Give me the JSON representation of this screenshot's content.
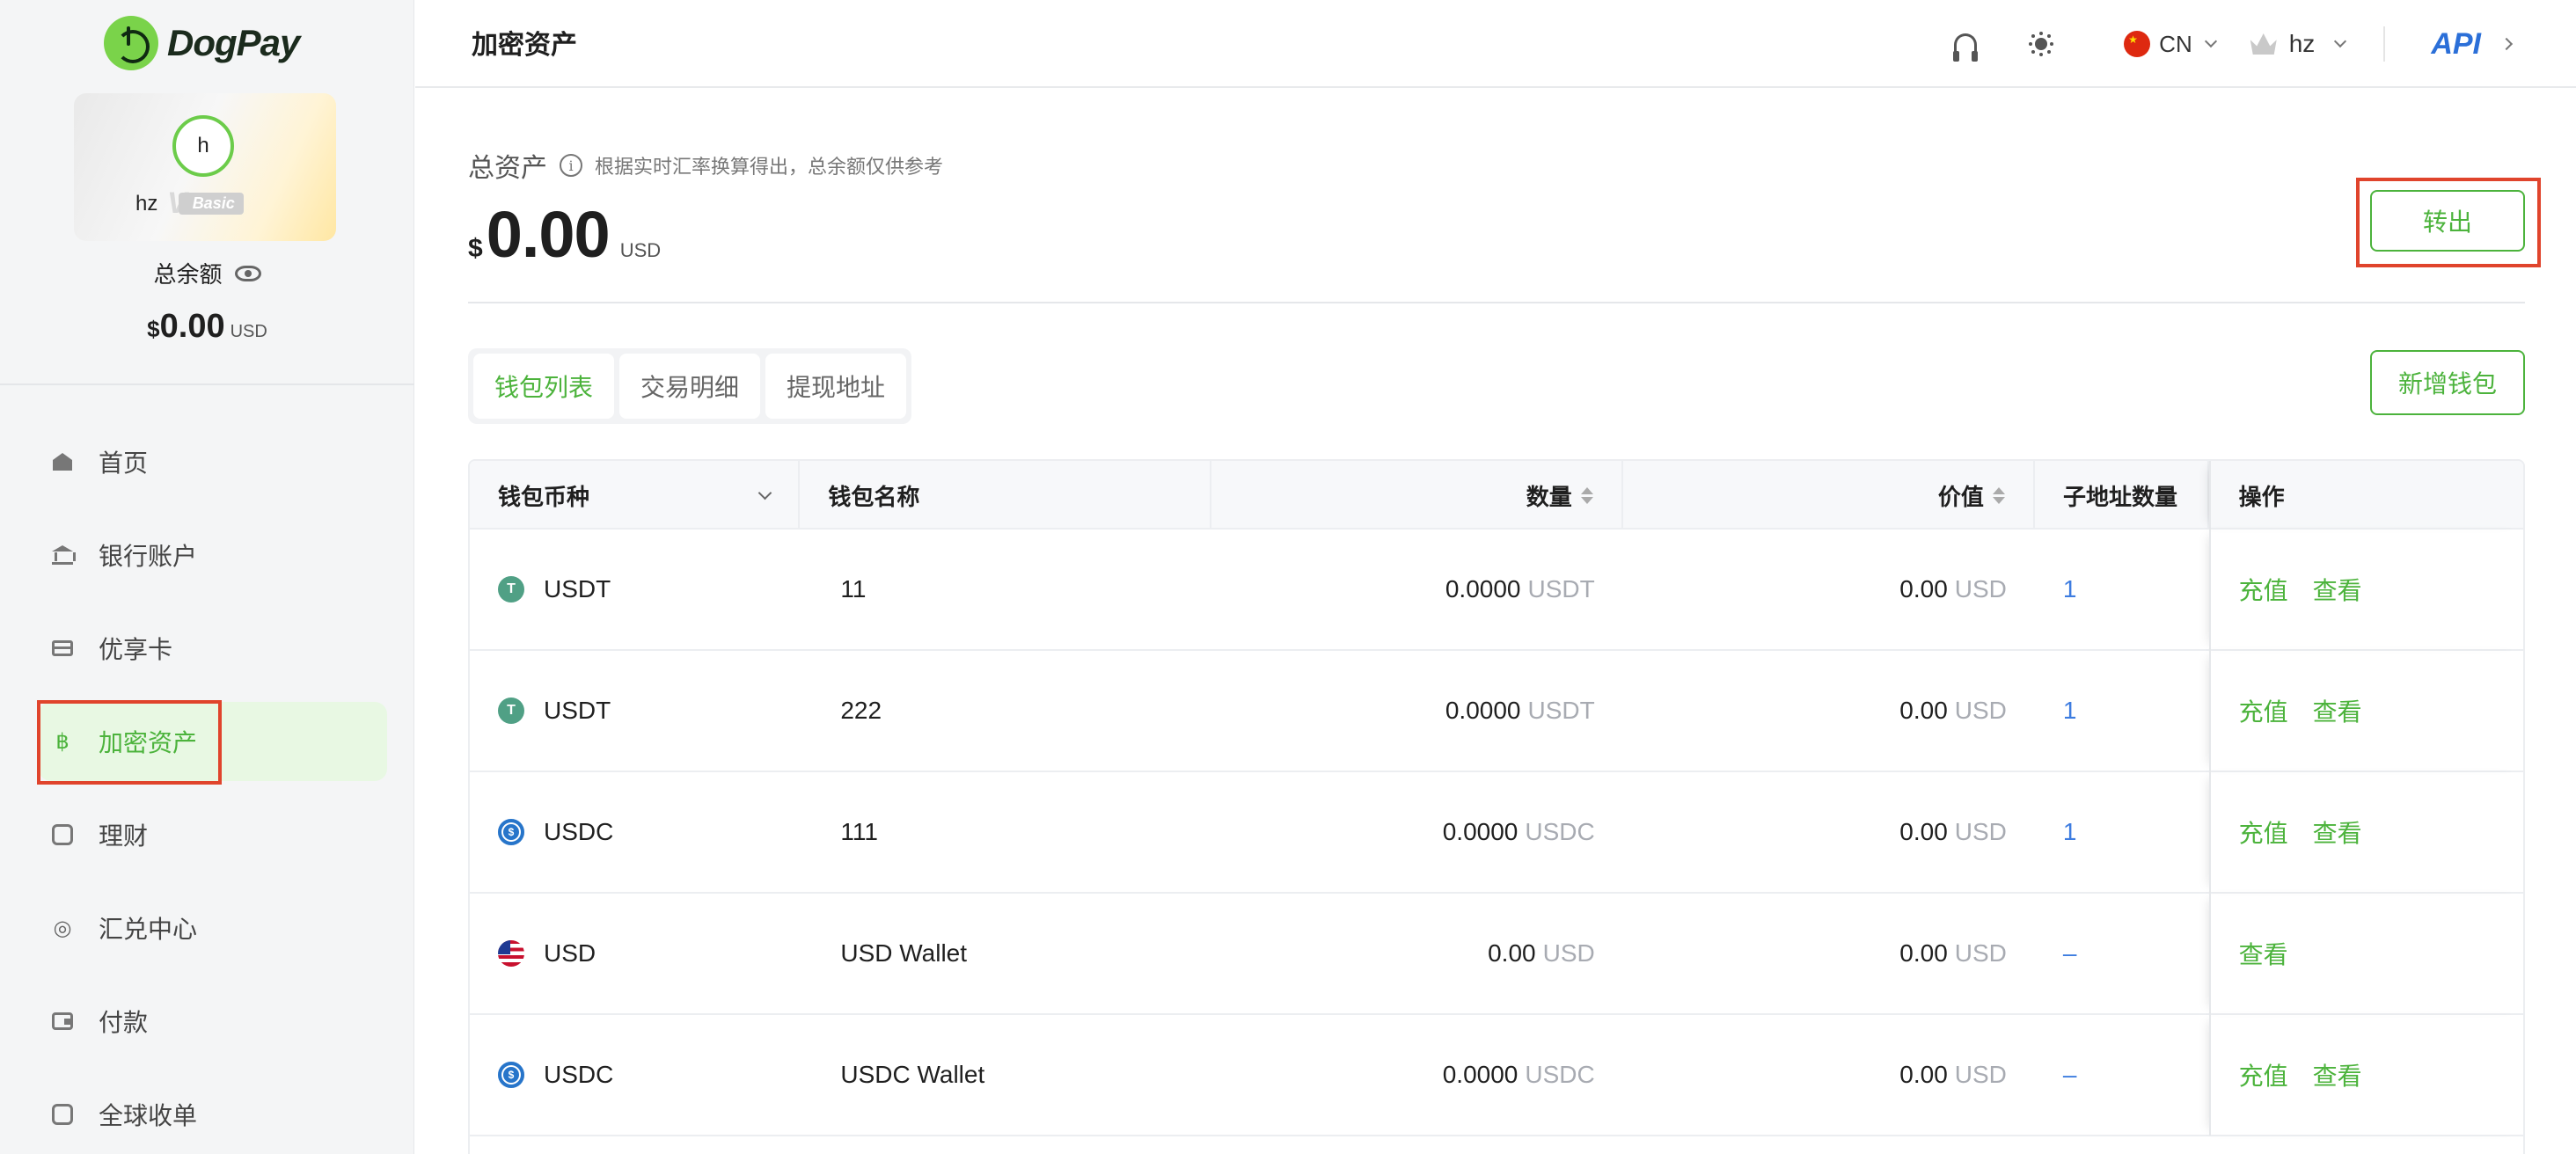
{
  "brand": {
    "name": "DogPay"
  },
  "profile": {
    "avatar_initial": "h",
    "name": "hz",
    "tier_letter": "V",
    "tier_label": "Basic",
    "balance_label": "总余额",
    "currency_symbol": "$",
    "balance": "0.00",
    "balance_unit": "USD"
  },
  "sidebar": {
    "items": [
      {
        "label": "首页",
        "icon": "home-icon"
      },
      {
        "label": "银行账户",
        "icon": "bank-icon"
      },
      {
        "label": "优享卡",
        "icon": "card-icon"
      },
      {
        "label": "加密资产",
        "icon": "bitcoin-icon",
        "active": true
      },
      {
        "label": "理财",
        "icon": "finance-icon"
      },
      {
        "label": "汇兑中心",
        "icon": "exchange-icon"
      },
      {
        "label": "付款",
        "icon": "wallet-icon"
      },
      {
        "label": "全球收单",
        "icon": "receipt-icon"
      }
    ]
  },
  "header": {
    "title": "加密资产",
    "language": "CN",
    "user": "hz",
    "api_label": "API"
  },
  "summary": {
    "label": "总资产",
    "hint": "根据实时汇率换算得出，总余额仅供参考",
    "currency_symbol": "$",
    "amount": "0.00",
    "unit": "USD",
    "withdraw_label": "转出"
  },
  "tabs": [
    {
      "label": "钱包列表",
      "active": true
    },
    {
      "label": "交易明细"
    },
    {
      "label": "提现地址"
    }
  ],
  "add_wallet_label": "新增钱包",
  "table": {
    "headers": {
      "currency": "钱包币种",
      "name": "钱包名称",
      "quantity": "数量",
      "value": "价值",
      "sub_count": "子地址数量",
      "actions": "操作"
    },
    "action_labels": {
      "recharge": "充值",
      "view": "查看"
    },
    "rows": [
      {
        "coin": "USDT",
        "icon": "tether-icon",
        "name": "11",
        "qty": "0.0000",
        "qty_unit": "USDT",
        "value": "0.00",
        "value_unit": "USD",
        "sub": "1",
        "recharge": "充值",
        "view": "查看"
      },
      {
        "coin": "USDT",
        "icon": "tether-icon",
        "name": "222",
        "qty": "0.0000",
        "qty_unit": "USDT",
        "value": "0.00",
        "value_unit": "USD",
        "sub": "1",
        "recharge": "充值",
        "view": "查看"
      },
      {
        "coin": "USDC",
        "icon": "usdc-icon",
        "name": "111",
        "qty": "0.0000",
        "qty_unit": "USDC",
        "value": "0.00",
        "value_unit": "USD",
        "sub": "1",
        "recharge": "充值",
        "view": "查看"
      },
      {
        "coin": "USD",
        "icon": "us-flag-icon",
        "name": "USD Wallet",
        "qty": "0.00",
        "qty_unit": "USD",
        "value": "0.00",
        "value_unit": "USD",
        "sub": "–",
        "recharge": "",
        "view": "查看"
      },
      {
        "coin": "USDC",
        "icon": "usdc-icon",
        "name": "USDC Wallet",
        "qty": "0.0000",
        "qty_unit": "USDC",
        "value": "0.00",
        "value_unit": "USD",
        "sub": "–",
        "recharge": "充值",
        "view": "查看"
      }
    ]
  }
}
